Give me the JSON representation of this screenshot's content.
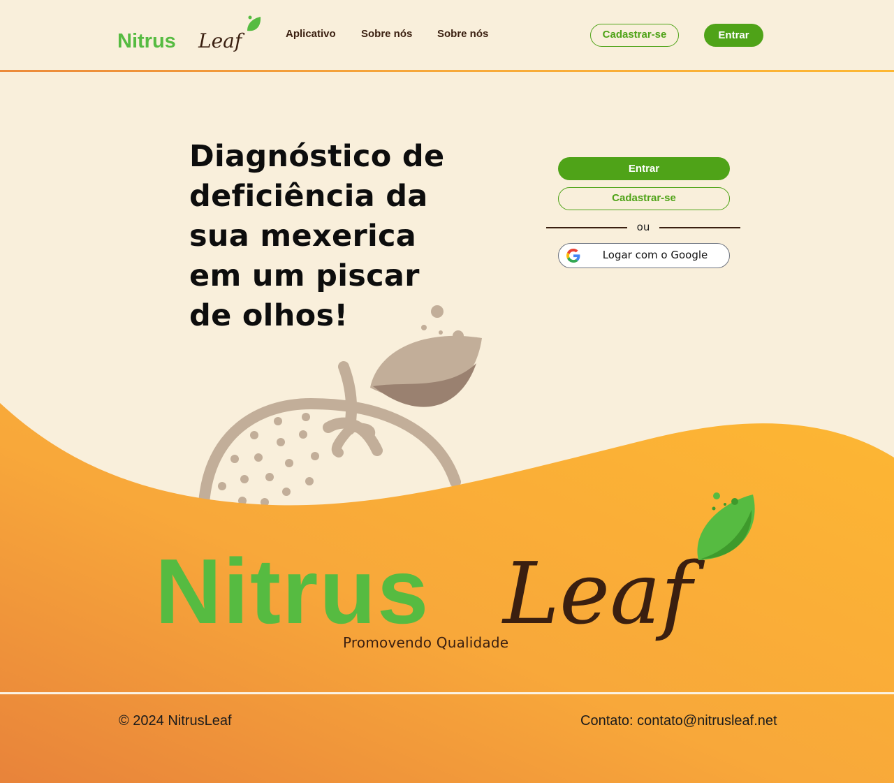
{
  "brand": {
    "name_part1": "Nitrus",
    "name_part2": "Leaf",
    "tagline": "Promovendo Qualidade",
    "green": "#4fa318",
    "logo_green": "#56bb41",
    "brown": "#3a1f10",
    "orange_start": "#ec8a3a",
    "orange_end": "#fdb733",
    "cream": "#f9efdb"
  },
  "header": {
    "nav": [
      "Aplicativo",
      "Sobre nós",
      "Sobre nós"
    ],
    "register_label": "Cadastrar-se",
    "login_label": "Entrar"
  },
  "hero": {
    "heading_lines": [
      "Diagnóstico de",
      "deficiência da",
      "sua mexerica",
      "em um piscar",
      "de olhos!"
    ]
  },
  "auth": {
    "login_label": "Entrar",
    "register_label": "Cadastrar-se",
    "divider_text": "ou",
    "google_label": "Logar com o Google",
    "google_icon": "google-g-icon"
  },
  "illustration": {
    "subject": "tangerine-with-leaf-icon"
  },
  "footer": {
    "copyright": "© 2024 NitrusLeaf",
    "contact": "Contato: contato@nitrusleaf.net"
  }
}
